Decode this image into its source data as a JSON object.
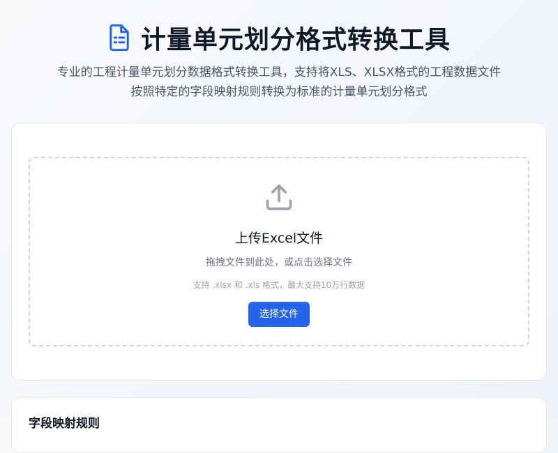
{
  "header": {
    "title": "计量单元划分格式转换工具",
    "subtitle_line1": "专业的工程计量单元划分数据格式转换工具，支持将XLS、XLSX格式的工程数据文件",
    "subtitle_line2": "按照特定的字段映射规则转换为标准的计量单元划分格式",
    "icon": "document-icon"
  },
  "upload": {
    "icon": "upload-icon",
    "title": "上传Excel文件",
    "hint": "拖拽文件到此处，或点击选择文件",
    "formats": "支持 .xlsx 和 .xls 格式，最大支持10万行数据",
    "button_label": "选择文件"
  },
  "mapping": {
    "title": "字段映射规则"
  },
  "colors": {
    "accent": "#2563eb",
    "title": "#111827",
    "muted": "#6b7280"
  }
}
